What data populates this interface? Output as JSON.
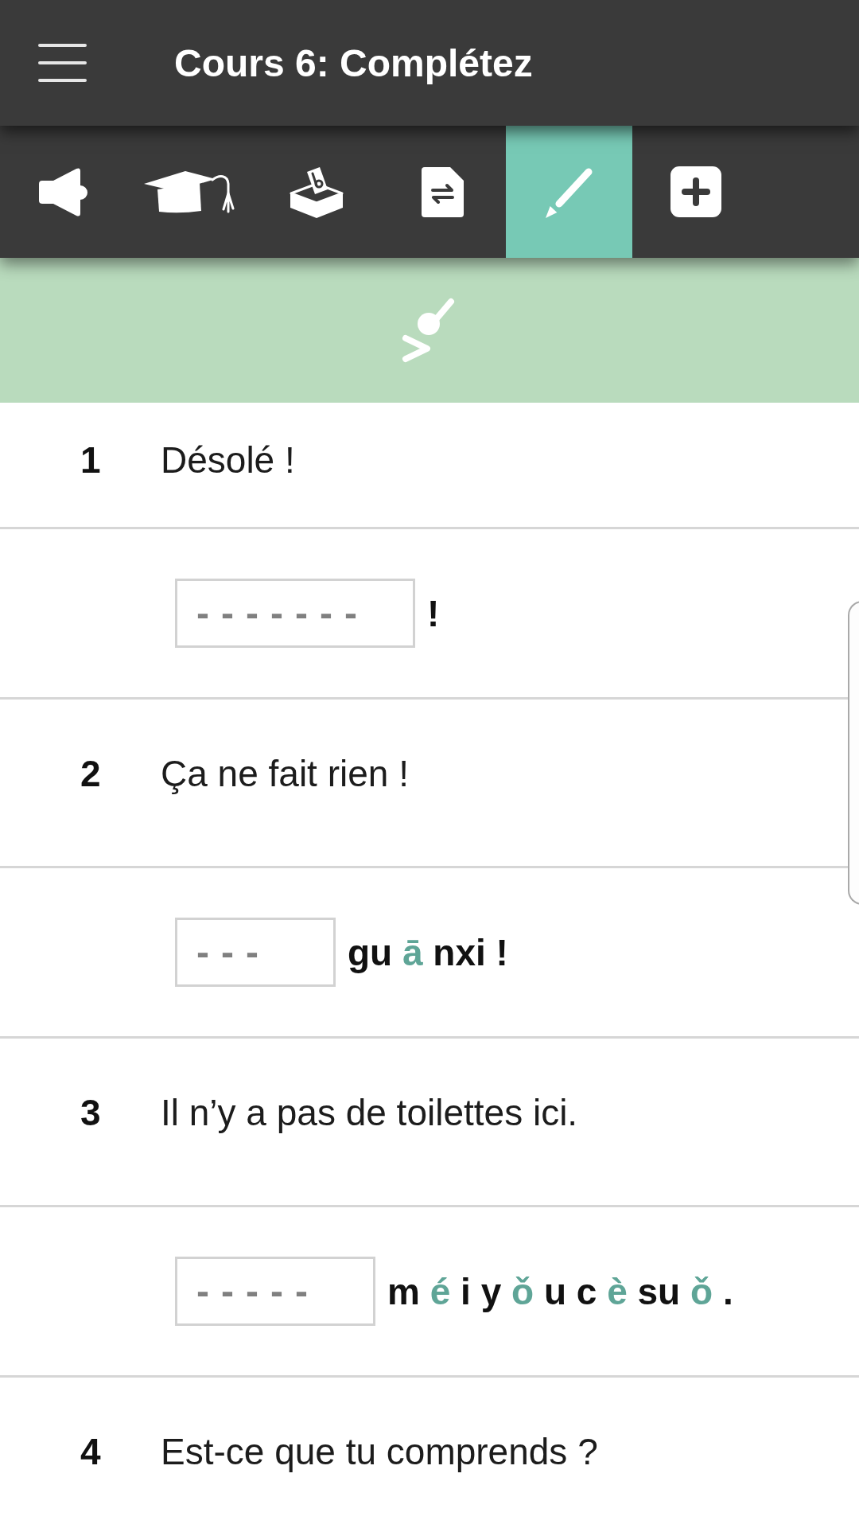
{
  "header": {
    "title": "Cours 6: Complétez"
  },
  "tabs": [
    {
      "kind": "speaker",
      "selected": false
    },
    {
      "kind": "cap",
      "selected": false
    },
    {
      "kind": "ballot",
      "selected": false
    },
    {
      "kind": "document",
      "selected": false
    },
    {
      "kind": "pencil",
      "selected": true
    },
    {
      "kind": "plus",
      "selected": false
    }
  ],
  "exercises": [
    {
      "number": "1",
      "sentence": "Désolé !",
      "answer": {
        "placeholder": "-------",
        "parts": [
          {
            "text": "!",
            "tone": false
          }
        ]
      }
    },
    {
      "number": "2",
      "sentence": "Ça ne fait rien !",
      "answer": {
        "placeholder": "---",
        "parts": [
          {
            "text": "gu",
            "tone": false
          },
          {
            "text": "ā",
            "tone": true
          },
          {
            "text": "nxi !",
            "tone": false
          }
        ]
      }
    },
    {
      "number": "3",
      "sentence": "Il n’y a pas de toilettes ici.",
      "answer": {
        "placeholder": "-----",
        "parts": [
          {
            "text": "m",
            "tone": false
          },
          {
            "text": "é",
            "tone": true
          },
          {
            "text": "i",
            "tone": false
          },
          {
            "text": "y",
            "tone": false
          },
          {
            "text": "ǒ",
            "tone": true
          },
          {
            "text": "u",
            "tone": false
          },
          {
            "text": "c",
            "tone": false
          },
          {
            "text": "è",
            "tone": true
          },
          {
            "text": "su",
            "tone": false
          },
          {
            "text": "ǒ",
            "tone": true
          },
          {
            "text": ".",
            "tone": false
          }
        ]
      }
    },
    {
      "number": "4",
      "sentence": "Est-ce que tu comprends ?"
    }
  ]
}
